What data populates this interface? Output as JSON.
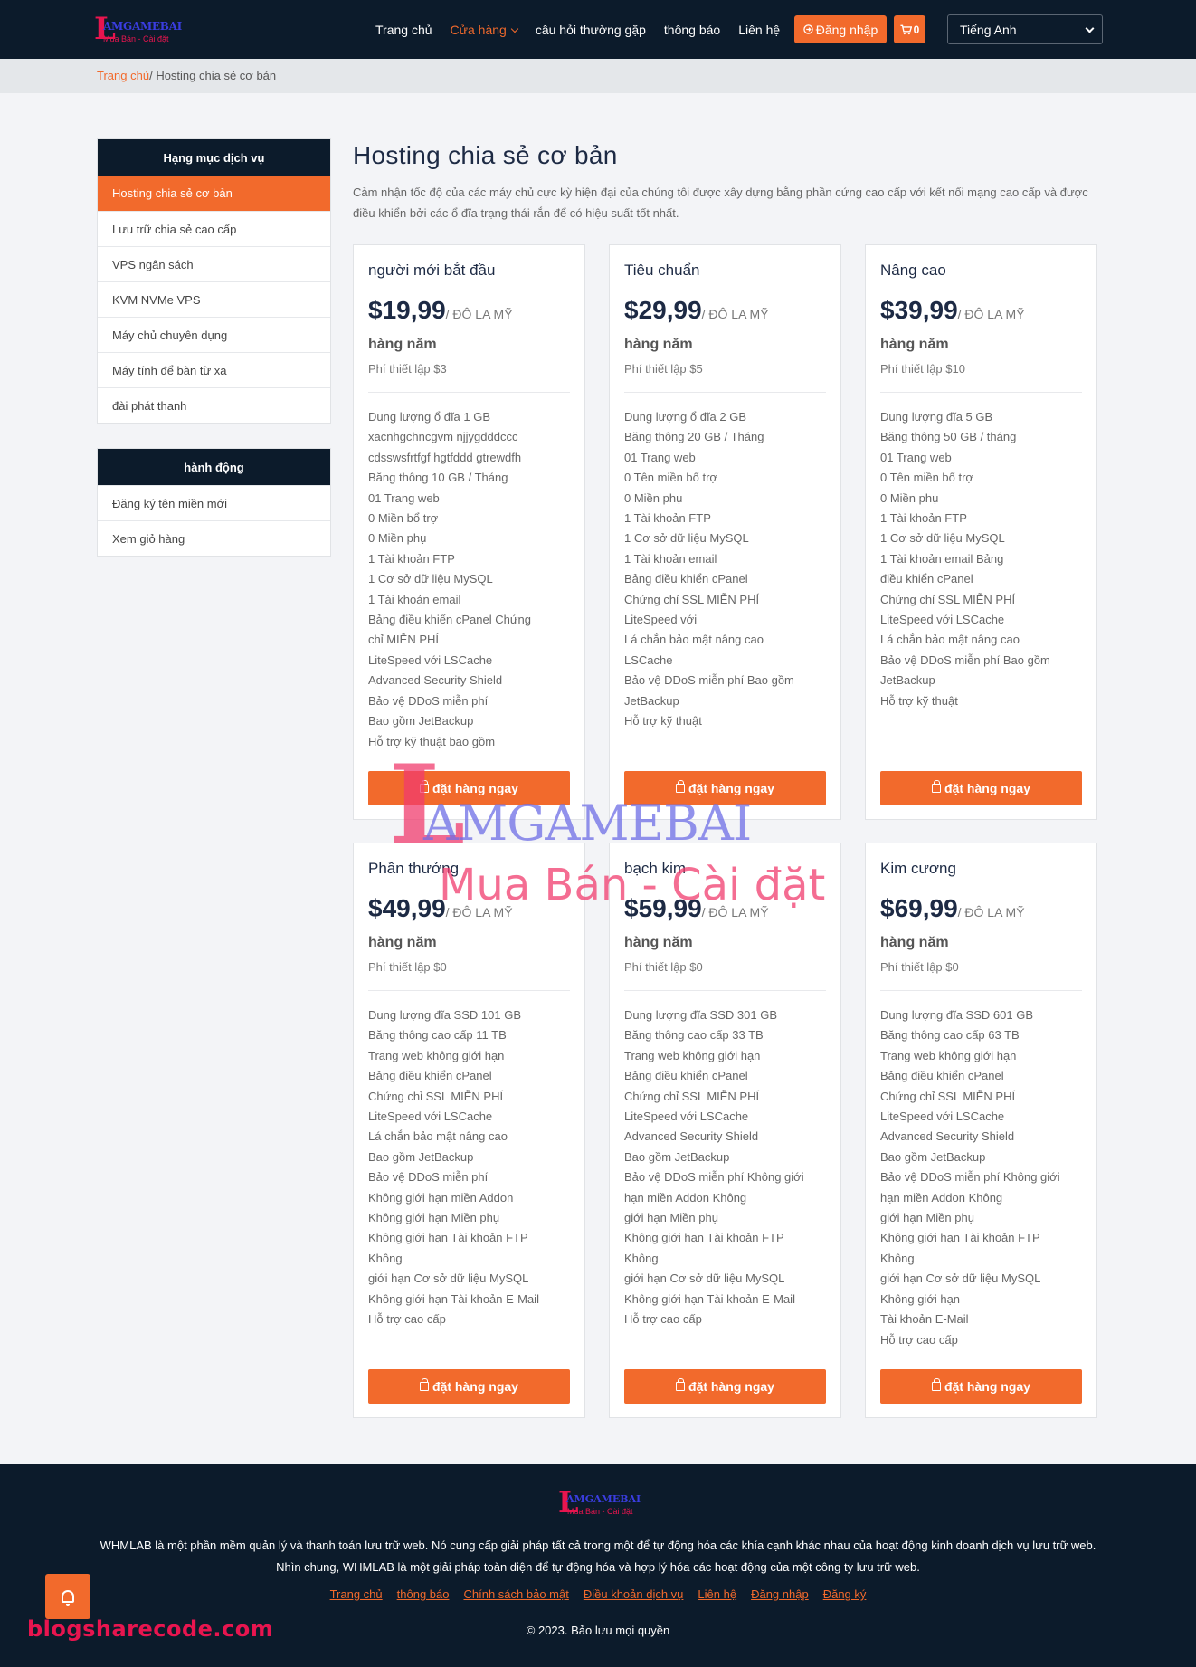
{
  "brand": {
    "logo_word": "AMGAMEBAI",
    "logo_sub": "Mua Bán - Cài đặt"
  },
  "nav": {
    "links": [
      "Trang chủ",
      "Cửa hàng",
      "câu hỏi thường gặp",
      "thông báo",
      "Liên hệ"
    ],
    "login_label": "Đăng nhập",
    "cart_count": "0",
    "language": "Tiếng Anh"
  },
  "breadcrumb": {
    "home": "Trang chủ",
    "separator": "/",
    "current": "Hosting chia sẻ cơ bản"
  },
  "sidebar": {
    "categories_title": "Hạng mục dịch vụ",
    "categories": [
      "Hosting chia sẻ cơ bản",
      "Lưu trữ chia sẻ cao cấp",
      "VPS ngân sách",
      "KVM NVMe VPS",
      "Máy chủ chuyên dụng",
      "Máy tính để bàn từ xa",
      "đài phát thanh"
    ],
    "actions_title": "hành động",
    "actions": [
      "Đăng ký tên miền mới",
      "Xem giỏ hàng"
    ]
  },
  "page": {
    "title": "Hosting chia sẻ cơ bản",
    "description": "Cảm nhận tốc độ của các máy chủ cực kỳ hiện đại của chúng tôi được xây dựng bằng phần cứng cao cấp với kết nối mạng cao cấp và được điều khiển bởi các ổ đĩa trạng thái rắn để có hiệu suất tốt nhất."
  },
  "order_label": "đặt hàng ngay",
  "plans": [
    {
      "name": "người mới bắt đầu",
      "price": "$19,99",
      "unit": "/ ĐÔ LA MỸ",
      "cycle": "hàng năm",
      "setup": "Phí thiết lập $3",
      "features": [
        "Dung lượng ổ đĩa 1 GB",
        "xacnhgchncgvm njjygdddccc",
        "cdsswsfrtfgf hgtfddd gtrewdfh",
        "Băng thông 10 GB / Tháng",
        "01 Trang web",
        "0 Miền bổ trợ",
        "0 Miền phụ",
        "1 Tài khoản FTP",
        "1 Cơ sở dữ liệu MySQL",
        "1 Tài khoản email",
        "Bảng điều khiển cPanel Chứng",
        "chỉ MIỄN PHÍ",
        "LiteSpeed với LSCache",
        "Advanced Security Shield",
        "Bảo vệ DDoS miễn phí",
        "Bao gồm JetBackup",
        "Hỗ trợ kỹ thuật bao gồm"
      ]
    },
    {
      "name": "Tiêu chuẩn",
      "price": "$29,99",
      "unit": "/ ĐÔ LA MỸ",
      "cycle": "hàng năm",
      "setup": "Phí thiết lập $5",
      "features": [
        "Dung lượng ổ đĩa 2 GB",
        "Băng thông 20 GB / Tháng",
        "01 Trang web",
        "0 Tên miền bổ trợ",
        "0 Miền phụ",
        "1 Tài khoản FTP",
        "1 Cơ sở dữ liệu MySQL",
        "1 Tài khoản email",
        "Bảng điều khiển cPanel",
        "Chứng chỉ SSL MIỄN PHÍ",
        "LiteSpeed với",
        "Lá chắn bảo mật nâng cao",
        "LSCache",
        "Bảo vệ DDoS miễn phí Bao gồm",
        "JetBackup",
        "Hỗ trợ kỹ thuật"
      ]
    },
    {
      "name": "Nâng cao",
      "price": "$39,99",
      "unit": "/ ĐÔ LA MỸ",
      "cycle": "hàng năm",
      "setup": "Phí thiết lập $10",
      "features": [
        "Dung lượng đĩa 5 GB",
        "Băng thông 50 GB / tháng",
        "01 Trang web",
        "0 Tên miền bổ trợ",
        "0 Miền phụ",
        "1 Tài khoản FTP",
        "1 Cơ sở dữ liệu MySQL",
        "1 Tài khoản email Bảng",
        "điều khiển cPanel",
        "Chứng chỉ SSL MIỄN PHÍ",
        "LiteSpeed với LSCache",
        "Lá chắn bảo mật nâng cao",
        "Bảo vệ DDoS miễn phí Bao gồm",
        "JetBackup",
        "Hỗ trợ kỹ thuật"
      ]
    },
    {
      "name": "Phần thưởng",
      "price": "$49,99",
      "unit": "/ ĐÔ LA MỸ",
      "cycle": "hàng năm",
      "setup": "Phí thiết lập $0",
      "features": [
        "Dung lượng đĩa SSD 101 GB",
        "Băng thông cao cấp 11 TB",
        "Trang web không giới hạn",
        "Bảng điều khiển cPanel",
        "Chứng chỉ SSL MIỄN PHÍ",
        "LiteSpeed với LSCache",
        "Lá chắn bảo mật nâng cao",
        "Bao gồm JetBackup",
        "Bảo vệ DDoS miễn phí",
        "Không giới hạn miền Addon",
        "Không giới hạn Miền phụ",
        "Không giới hạn Tài khoản FTP",
        "Không",
        "giới hạn Cơ sở dữ liệu MySQL",
        "Không giới hạn Tài khoản E-Mail",
        "Hỗ trợ cao cấp"
      ]
    },
    {
      "name": "bạch kim",
      "price": "$59,99",
      "unit": "/ ĐÔ LA MỸ",
      "cycle": "hàng năm",
      "setup": "Phí thiết lập $0",
      "features": [
        "Dung lượng đĩa SSD 301 GB",
        "Băng thông cao cấp 33 TB",
        "Trang web không giới hạn",
        "Bảng điều khiển cPanel",
        "Chứng chỉ SSL MIỄN PHÍ",
        "LiteSpeed với LSCache",
        "Advanced Security Shield",
        "Bao gồm JetBackup",
        "Bảo vệ DDoS miễn phí Không giới",
        "hạn miền Addon Không",
        "giới hạn Miền phụ",
        "Không giới hạn Tài khoản FTP",
        "Không",
        "giới hạn Cơ sở dữ liệu MySQL",
        "Không giới hạn Tài khoản E-Mail",
        "Hỗ trợ cao cấp"
      ]
    },
    {
      "name": "Kim cương",
      "price": "$69,99",
      "unit": "/ ĐÔ LA MỸ",
      "cycle": "hàng năm",
      "setup": "Phí thiết lập $0",
      "features": [
        "Dung lượng đĩa SSD 601 GB",
        "Băng thông cao cấp 63 TB",
        "Trang web không giới hạn",
        "Bảng điều khiển cPanel",
        "Chứng chỉ SSL MIỄN PHÍ",
        "LiteSpeed với LSCache",
        "Advanced Security Shield",
        "Bao gồm JetBackup",
        "Bảo vệ DDoS miễn phí Không giới",
        "hạn miền Addon Không",
        "giới hạn Miền phụ",
        "Không giới hạn Tài khoản FTP",
        "Không",
        "giới hạn Cơ sở dữ liệu MySQL",
        "Không giới hạn",
        "Tài khoản E-Mail",
        "Hỗ trợ cao cấp"
      ]
    }
  ],
  "watermark": {
    "word": "AMGAMEBAI",
    "sub": "Mua Bán - Cài đặt"
  },
  "footer": {
    "description": "WHMLAB là một phần mềm quản lý và thanh toán lưu trữ web. Nó cung cấp giải pháp tất cả trong một để tự động hóa các khía cạnh khác nhau của hoạt động kinh doanh dịch vụ lưu trữ web. Nhìn chung, WHMLAB là một giải pháp toàn diện để tự động hóa và hợp lý hóa các hoạt động của một công ty lưu trữ web.",
    "links": [
      "Trang chủ",
      "thông báo",
      "Chính sách bảo mật",
      "Điều khoản dịch vụ",
      "Liên hệ",
      "Đăng nhập",
      "Đăng ký"
    ],
    "copyright": "© 2023. Bảo lưu mọi quyền"
  },
  "site_mark": "blogsharecode.com",
  "colors": {
    "navy": "#0c1b2b",
    "accent": "#f26a2c",
    "brand_red": "#e8154f"
  }
}
